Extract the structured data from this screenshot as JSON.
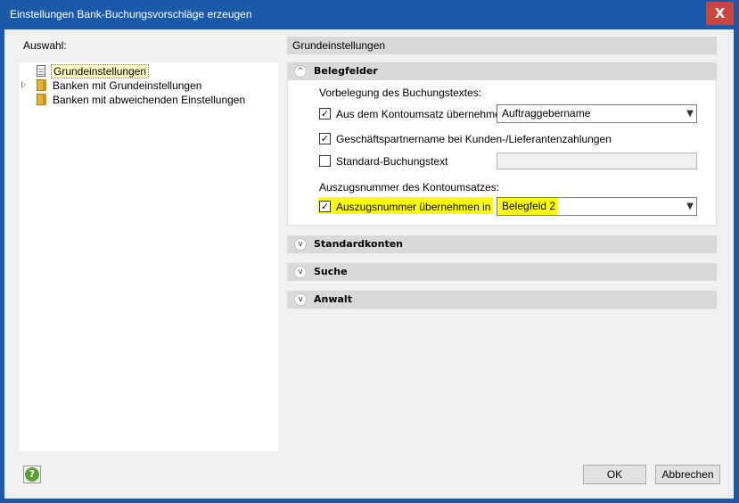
{
  "window": {
    "title": "Einstellungen Bank-Buchungsvorschläge erzeugen",
    "close_label": "X"
  },
  "left": {
    "label": "Auswahl:",
    "tree": [
      {
        "label": "Grundeinstellungen",
        "icon": "document-icon",
        "selected": true,
        "expandable": false
      },
      {
        "label": "Banken mit Grundeinstellungen",
        "icon": "folder-icon",
        "selected": false,
        "expandable": true
      },
      {
        "label": "Banken mit abweichenden Einstellungen",
        "icon": "folder-icon",
        "selected": false,
        "expandable": false
      }
    ]
  },
  "right": {
    "header": "Grundeinstellungen",
    "groups": [
      {
        "title": "Belegfelder",
        "expanded": true,
        "chevron": "^"
      },
      {
        "title": "Standardkonten",
        "expanded": false,
        "chevron": "v"
      },
      {
        "title": "Suche",
        "expanded": false,
        "chevron": "v"
      },
      {
        "title": "Anwalt",
        "expanded": false,
        "chevron": "v"
      }
    ],
    "belegfelder": {
      "section1_label": "Vorbelegung des Buchungstextes:",
      "option1": {
        "label": "Aus dem Kontoumsatz übernehmen",
        "checked": true,
        "value": "Auftraggebername"
      },
      "option2": {
        "label": "Geschäftspartnername bei Kunden-/Lieferantenzahlungen",
        "checked": true
      },
      "option3": {
        "label": "Standard-Buchungstext",
        "checked": false,
        "value": ""
      },
      "section2_label": "Auszugsnummer des Kontoumsatzes:",
      "option4": {
        "label": "Auszugsnummer übernehmen in",
        "checked": true,
        "value": "Belegfeld 2"
      }
    }
  },
  "footer": {
    "help_label": "?",
    "ok_label": "OK",
    "cancel_label": "Abbrechen"
  },
  "colors": {
    "titlebar": "#1a5aa8",
    "close": "#c9463d",
    "highlight": "#ffff00",
    "selection": "#fffdc3"
  }
}
